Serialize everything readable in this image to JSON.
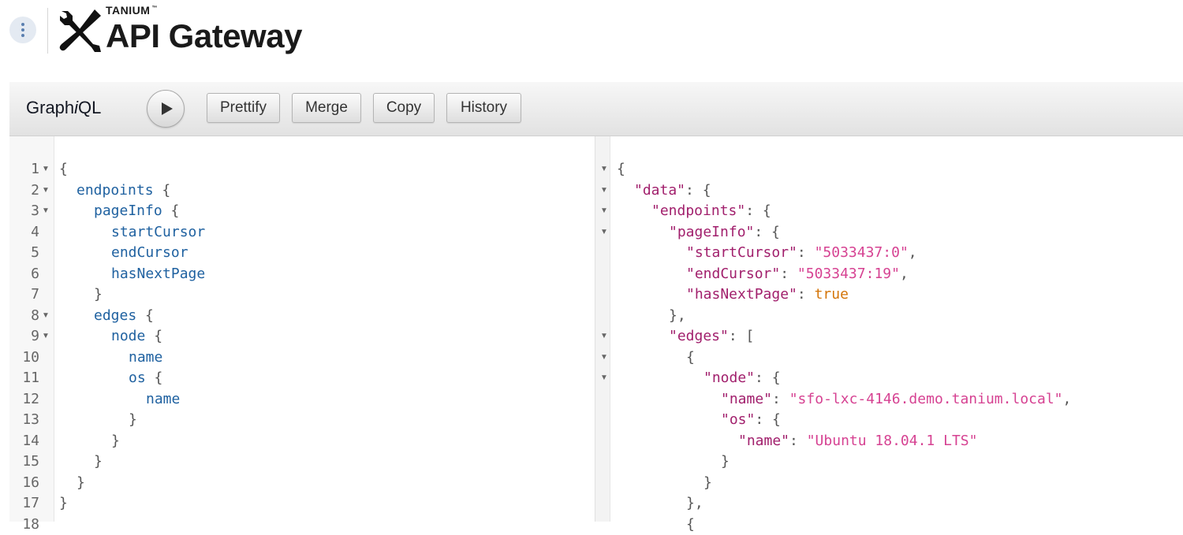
{
  "header": {
    "brand_small": "TANIUM",
    "brand_tm": "™",
    "title": "API Gateway",
    "menu_icon": "kebab-menu-icon",
    "logo_icon": "tools-wrench-screwdriver-icon"
  },
  "toolbar": {
    "title_prefix": "Graph",
    "title_italic": "i",
    "title_suffix": "QL",
    "run_icon": "play-icon",
    "buttons": [
      "Prettify",
      "Merge",
      "Copy",
      "History"
    ]
  },
  "query_editor": {
    "line_numbers": [
      "1",
      "2",
      "3",
      "4",
      "5",
      "6",
      "7",
      "8",
      "9",
      "10",
      "11",
      "12",
      "13",
      "14",
      "15",
      "16",
      "17",
      "18"
    ],
    "lines": [
      {
        "indent": 0,
        "text": "{"
      },
      {
        "indent": 1,
        "text": "endpoints",
        "tail": " {"
      },
      {
        "indent": 2,
        "text": "pageInfo",
        "tail": " {"
      },
      {
        "indent": 3,
        "text": "startCursor"
      },
      {
        "indent": 3,
        "text": "endCursor"
      },
      {
        "indent": 3,
        "text": "hasNextPage"
      },
      {
        "indent": 2,
        "text": "}"
      },
      {
        "indent": 2,
        "text": "edges",
        "tail": " {"
      },
      {
        "indent": 3,
        "text": "node",
        "tail": " {"
      },
      {
        "indent": 4,
        "text": "name"
      },
      {
        "indent": 4,
        "text": "os",
        "tail": " {"
      },
      {
        "indent": 5,
        "text": "name"
      },
      {
        "indent": 4,
        "text": "}"
      },
      {
        "indent": 3,
        "text": "}"
      },
      {
        "indent": 2,
        "text": "}"
      },
      {
        "indent": 1,
        "text": "}"
      },
      {
        "indent": 0,
        "text": "}"
      }
    ]
  },
  "result_viewer": {
    "lines": [
      {
        "indent": 0,
        "text": "{"
      },
      {
        "indent": 1,
        "key": "\"data\"",
        "tail": ": {"
      },
      {
        "indent": 2,
        "key": "\"endpoints\"",
        "tail": ": {"
      },
      {
        "indent": 3,
        "key": "\"pageInfo\"",
        "tail": ": {"
      },
      {
        "indent": 4,
        "key": "\"startCursor\"",
        "sep": ": ",
        "str": "\"5033437:0\"",
        "tail": ","
      },
      {
        "indent": 4,
        "key": "\"endCursor\"",
        "sep": ": ",
        "str": "\"5033437:19\"",
        "tail": ","
      },
      {
        "indent": 4,
        "key": "\"hasNextPage\"",
        "sep": ": ",
        "bool": "true"
      },
      {
        "indent": 3,
        "text": "},"
      },
      {
        "indent": 3,
        "key": "\"edges\"",
        "tail": ": ["
      },
      {
        "indent": 4,
        "text": "{"
      },
      {
        "indent": 5,
        "key": "\"node\"",
        "tail": ": {"
      },
      {
        "indent": 6,
        "key": "\"name\"",
        "sep": ": ",
        "str": "\"sfo-lxc-4146.demo.tanium.local\"",
        "tail": ","
      },
      {
        "indent": 6,
        "key": "\"os\"",
        "tail": ": {"
      },
      {
        "indent": 7,
        "key": "\"name\"",
        "sep": ": ",
        "str": "\"Ubuntu 18.04.1 LTS\""
      },
      {
        "indent": 6,
        "text": "}"
      },
      {
        "indent": 5,
        "text": "}"
      },
      {
        "indent": 4,
        "text": "},"
      },
      {
        "indent": 4,
        "text": "{"
      }
    ],
    "fold_rows": [
      0,
      1,
      2,
      3,
      8,
      9,
      10
    ]
  },
  "colors": {
    "field": "#1f61a0",
    "json_key": "#a11f6c",
    "json_string": "#d64292",
    "json_bool": "#d47509"
  }
}
